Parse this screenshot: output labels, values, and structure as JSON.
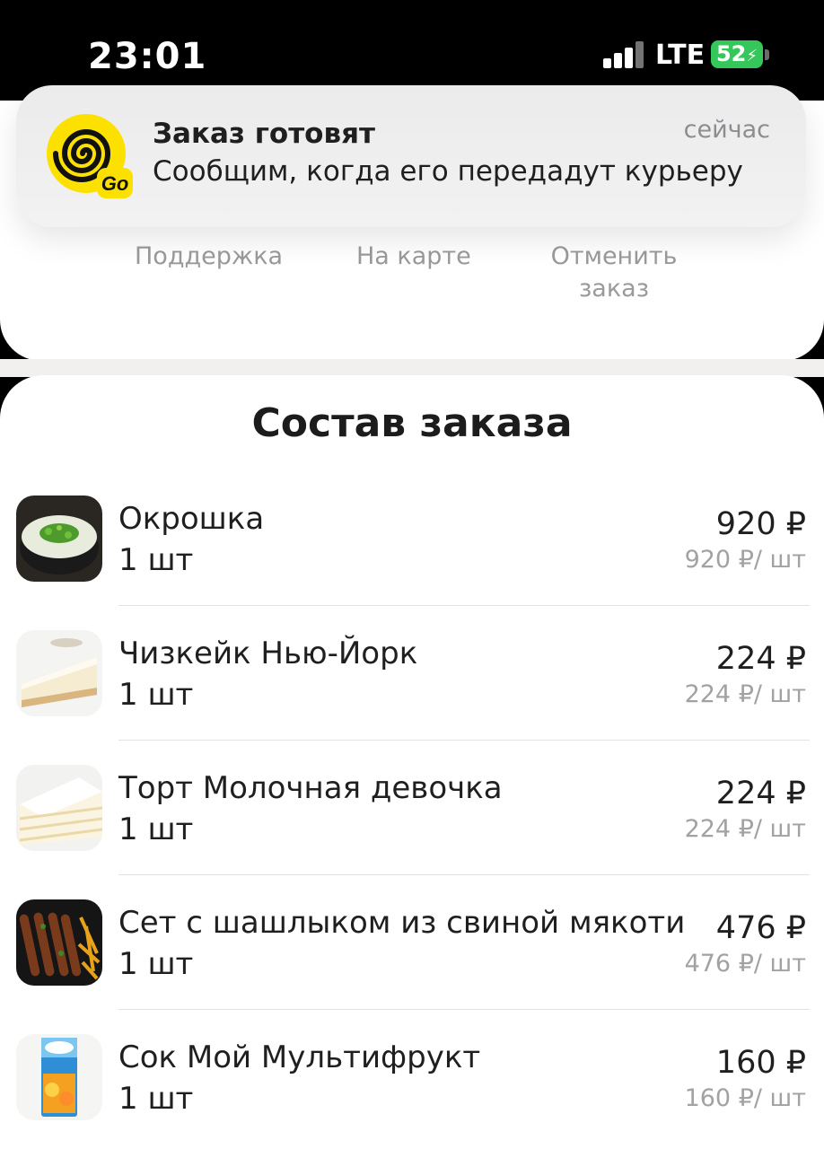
{
  "status_bar": {
    "time": "23:01",
    "network": "LTE",
    "battery": "52"
  },
  "notification": {
    "title": "Заказ готовят",
    "body": "Сообщим, когда его передадут курьеру",
    "time": "сейчас"
  },
  "actions": {
    "support": "Поддержка",
    "map": "На карте",
    "cancel": "Отменить заказ"
  },
  "order": {
    "title": "Состав заказа",
    "items": [
      {
        "name": "Окрошка",
        "qty": "1 шт",
        "price": "920 ₽",
        "unit": "920 ₽/ шт"
      },
      {
        "name": "Чизкейк Нью-Йорк",
        "qty": "1 шт",
        "price": "224 ₽",
        "unit": "224 ₽/ шт"
      },
      {
        "name": "Торт Молочная девочка",
        "qty": "1 шт",
        "price": "224 ₽",
        "unit": "224 ₽/ шт"
      },
      {
        "name": "Сет с шашлыком из свиной мякоти",
        "qty": "1 шт",
        "price": "476 ₽",
        "unit": "476 ₽/ шт"
      },
      {
        "name": "Сок Мой Мультифрукт",
        "qty": "1 шт",
        "price": "160 ₽",
        "unit": "160 ₽/ шт"
      }
    ]
  },
  "colors": {
    "accent_yellow": "#fce000",
    "battery_green": "#34c759"
  }
}
